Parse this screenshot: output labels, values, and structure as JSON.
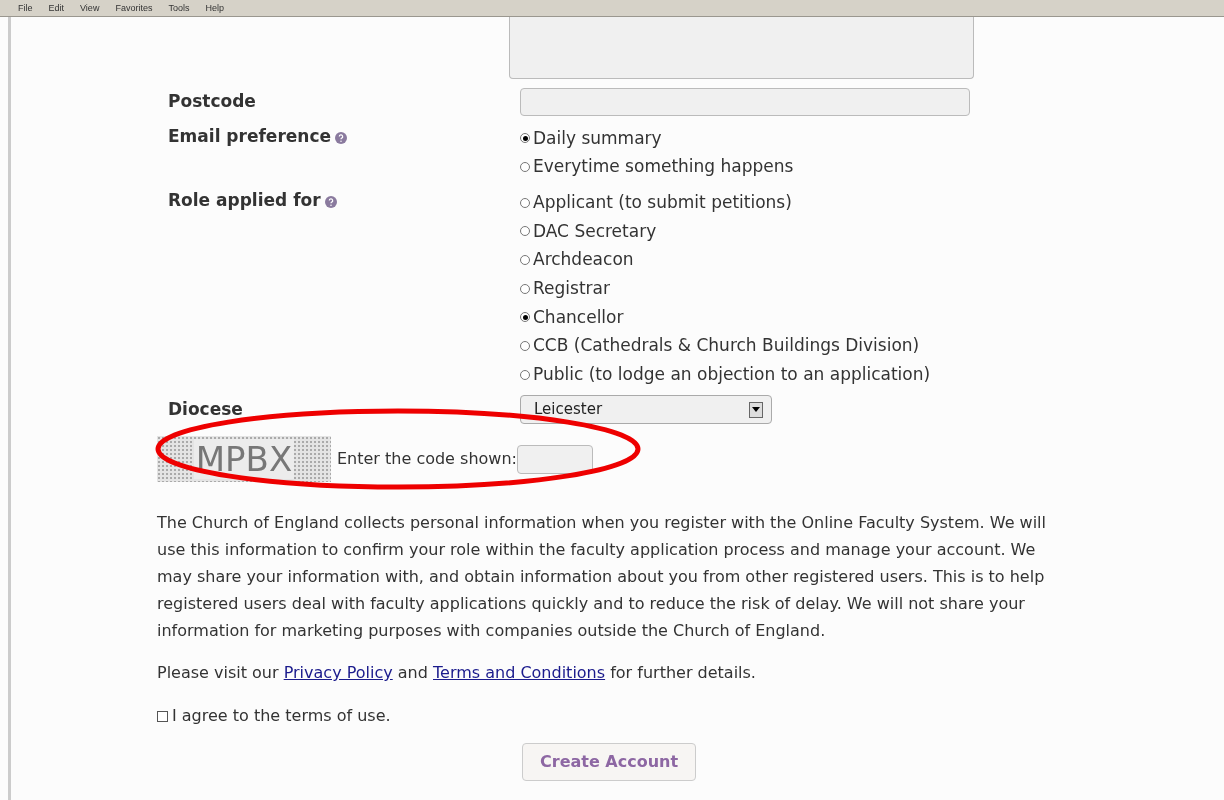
{
  "menu_bar": [
    "File",
    "Edit",
    "View",
    "Favorites",
    "Tools",
    "Help"
  ],
  "form": {
    "postcode": {
      "label": "Postcode"
    },
    "email_preference": {
      "label": "Email preference",
      "options": [
        {
          "label": "Daily summary",
          "selected": true
        },
        {
          "label": "Everytime something happens",
          "selected": false
        }
      ]
    },
    "role": {
      "label": "Role applied for",
      "options": [
        {
          "label": "Applicant (to submit petitions)",
          "selected": false
        },
        {
          "label": "DAC Secretary",
          "selected": false
        },
        {
          "label": "Archdeacon",
          "selected": false
        },
        {
          "label": "Registrar",
          "selected": false
        },
        {
          "label": "Chancellor",
          "selected": true
        },
        {
          "label": "CCB (Cathedrals & Church Buildings Division)",
          "selected": false
        },
        {
          "label": "Public (to lodge an objection to an application)",
          "selected": false
        }
      ]
    },
    "diocese": {
      "label": "Diocese",
      "value": "Leicester"
    },
    "captcha": {
      "code": "MPBX",
      "label": "Enter the code shown:"
    }
  },
  "privacy_text": "The Church of England collects personal information when you register with the Online Faculty System. We will use this information to confirm your role within the faculty application process and manage your account. We may share your information with, and obtain information about you from other registered users. This is to help registered users deal with faculty applications quickly and to reduce the risk of delay. We will not share your information for marketing purposes with companies outside the Church of England.",
  "visit_text": {
    "before": "Please visit our",
    "link1": "Privacy Policy",
    "middle": "and",
    "link2": "Terms and Conditions",
    "after": "for further details."
  },
  "agree": {
    "label": "I agree to the terms of use.",
    "checked": false
  },
  "submit": "Create Account"
}
